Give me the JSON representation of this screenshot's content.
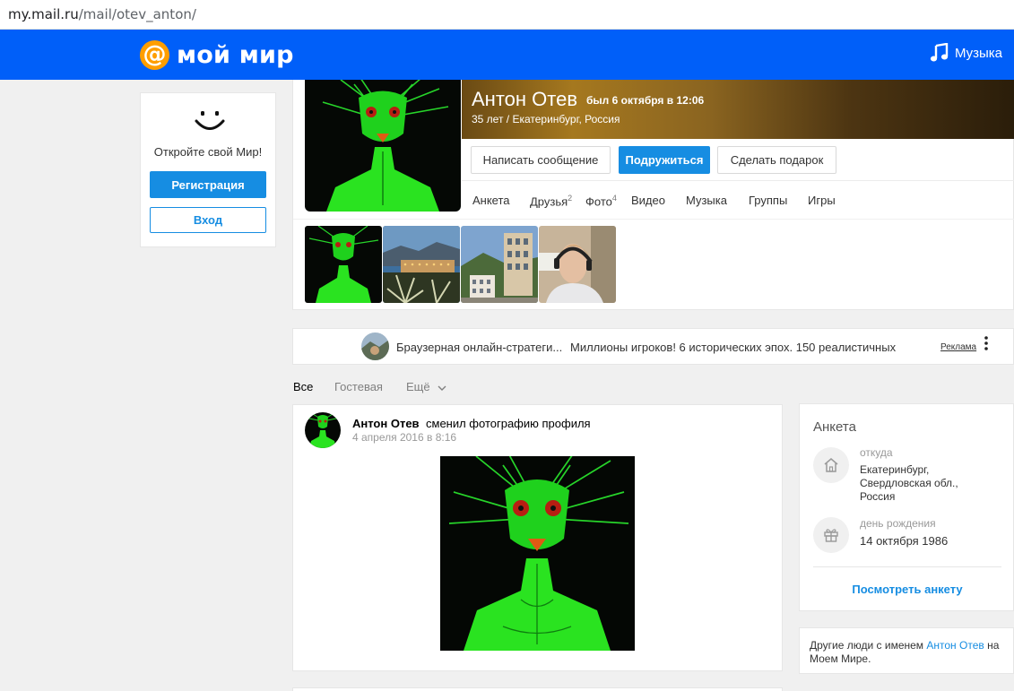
{
  "browser": {
    "url_host": "my.mail.ru",
    "url_path": "/mail/otev_anton/"
  },
  "header": {
    "logo_symbol": "@",
    "logo_text": "мой мир",
    "music_label": "Музыка",
    "bg_color": "#005ff9",
    "logo_accent": "#ff9e00"
  },
  "left_card": {
    "tagline": "Откройте свой Мир!",
    "register_label": "Регистрация",
    "login_label": "Вход"
  },
  "profile": {
    "name": "Антон Отев",
    "last_seen": "был 6 октября в 12:06",
    "meta": "35 лет / Екатеринбург, Россия",
    "actions": {
      "message": "Написать сообщение",
      "befriend": "Подружиться",
      "gift": "Сделать подарок"
    },
    "tabs": [
      {
        "label": "Анкета",
        "count": ""
      },
      {
        "label": "Друзья",
        "count": "2"
      },
      {
        "label": "Фото",
        "count": "4"
      },
      {
        "label": "Видео",
        "count": ""
      },
      {
        "label": "Музыка",
        "count": ""
      },
      {
        "label": "Группы",
        "count": ""
      },
      {
        "label": "Игры",
        "count": ""
      }
    ]
  },
  "ad": {
    "title": "Браузерная онлайн-стратеги...",
    "text": "Миллионы игроков! 6 исторических эпох. 150 реалистичных",
    "label": "Реклама"
  },
  "feed": {
    "filters": [
      "Все",
      "Гостевая",
      "Ещё"
    ]
  },
  "post": {
    "author": "Антон Отев",
    "action": "сменил фотографию профиля",
    "date": "4 апреля 2016 в 8:16"
  },
  "anketa": {
    "title": "Анкета",
    "from_label": "откуда",
    "from_value_1": "Екатеринбург,",
    "from_value_2": "Свердловская обл.,",
    "from_value_3": "Россия",
    "birthday_label": "день рождения",
    "birthday_value": "14 октября 1986",
    "link": "Посмотреть анкету"
  },
  "others": {
    "prefix": "Другие люди с именем",
    "name": "Антон Отев",
    "suffix_1": "на",
    "suffix_2": "Моем Мире."
  },
  "colors": {
    "accent": "#168de2",
    "page_bg": "#f0f0f0"
  }
}
